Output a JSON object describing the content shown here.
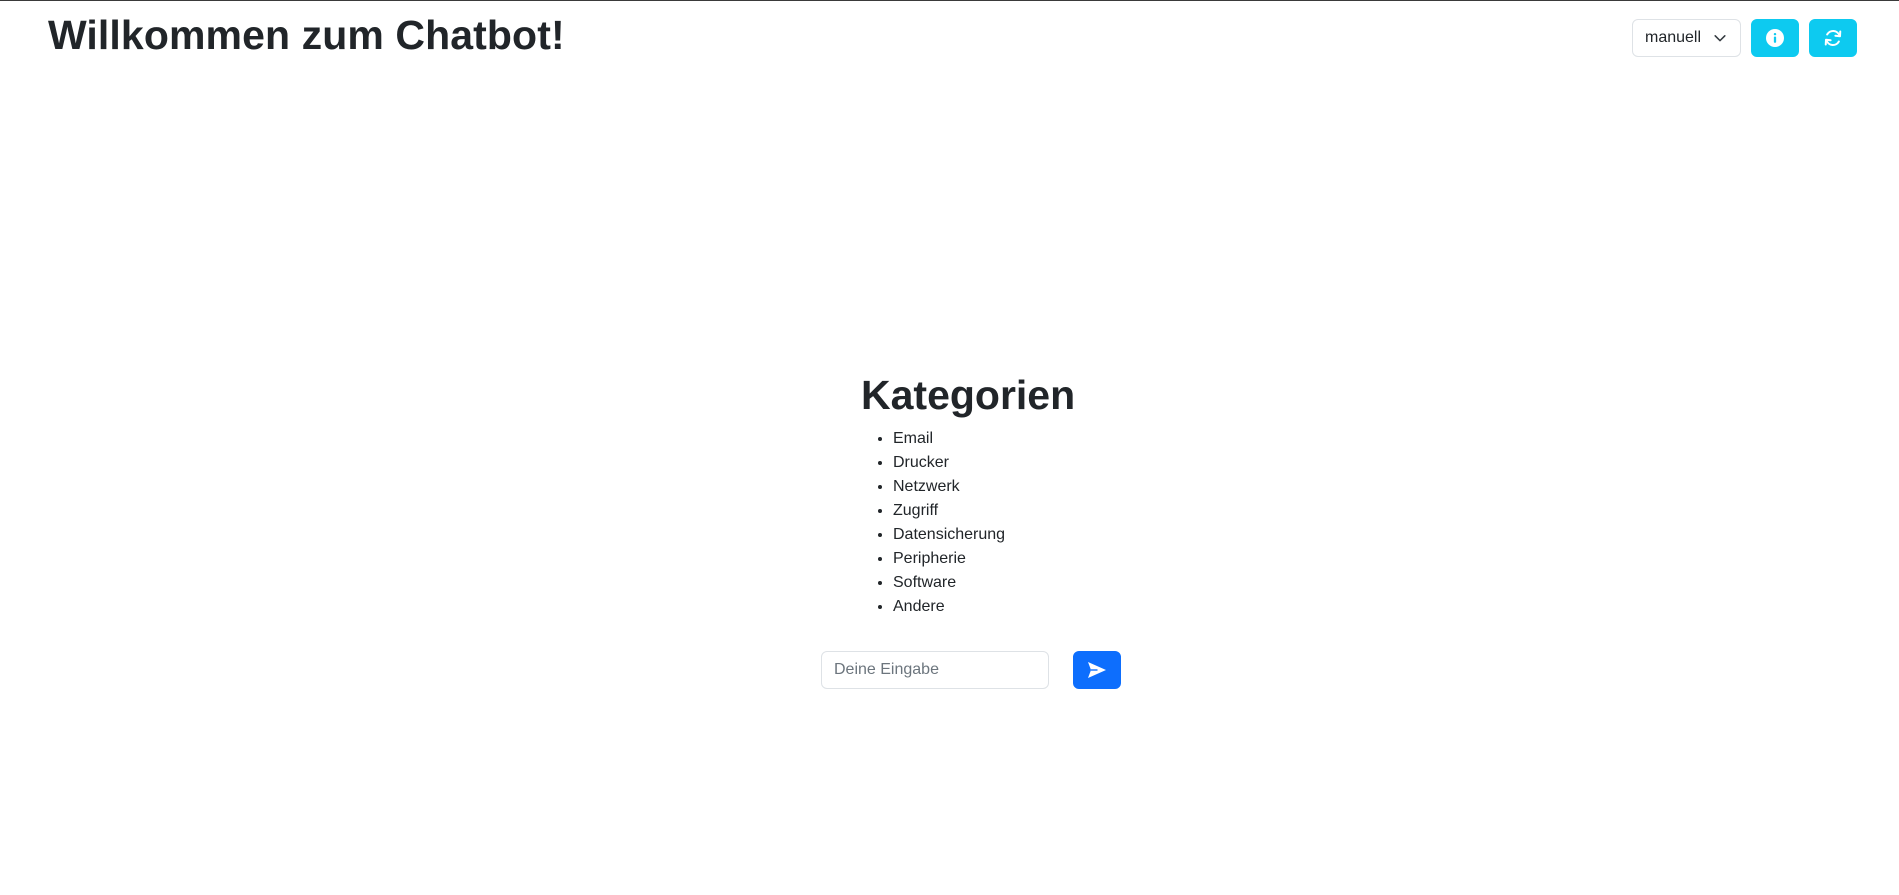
{
  "header": {
    "title": "Willkommen zum Chatbot!",
    "mode_select": {
      "selected": "manuell",
      "icon": "chevron-down-icon"
    },
    "info_button": {
      "icon": "info-icon",
      "color": "#0dcaf0"
    },
    "refresh_button": {
      "icon": "refresh-icon",
      "color": "#0dcaf0"
    }
  },
  "main": {
    "heading": "Kategorien",
    "categories": [
      "Email",
      "Drucker",
      "Netzwerk",
      "Zugriff",
      "Datensicherung",
      "Peripherie",
      "Software",
      "Andere"
    ]
  },
  "chat": {
    "input_value": "",
    "input_placeholder": "Deine Eingabe",
    "send_button": {
      "icon": "send-icon",
      "color": "#0d6efd"
    }
  }
}
